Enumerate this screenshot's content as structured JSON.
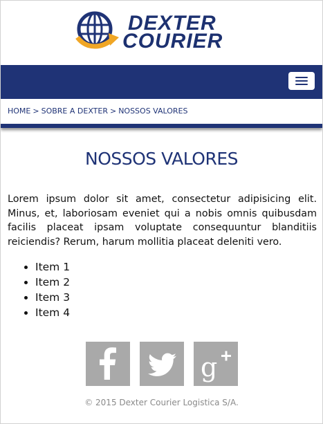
{
  "brand": {
    "line1": "DEXTER",
    "line2": "COURIER",
    "logo_icon": "globe-arrow-icon"
  },
  "nav": {
    "menu_icon": "hamburger-menu-icon"
  },
  "breadcrumb": {
    "items": [
      "HOME",
      "SOBRE A DEXTER",
      "NOSSOS VALORES"
    ],
    "separator": ">"
  },
  "page": {
    "title": "NOSSOS VALORES",
    "paragraph": "Lorem ipsum dolor sit amet, consectetur adipisicing elit. Minus, et, laboriosam eveniet qui a nobis omnis quibusdam facilis placeat ipsam voluptate consequuntur blanditiis reiciendis? Rerum, harum mollitia placeat deleniti vero.",
    "list": [
      "Item 1",
      "Item 2",
      "Item 3",
      "Item 4"
    ]
  },
  "social": [
    {
      "name": "facebook-icon"
    },
    {
      "name": "twitter-icon"
    },
    {
      "name": "google-plus-icon"
    }
  ],
  "footer": {
    "copyright": "© 2015 Dexter Courier Logistica S/A."
  },
  "colors": {
    "brand_navy": "#1f3376",
    "accent_orange": "#f0a625",
    "social_gray": "#a9a9a9"
  }
}
